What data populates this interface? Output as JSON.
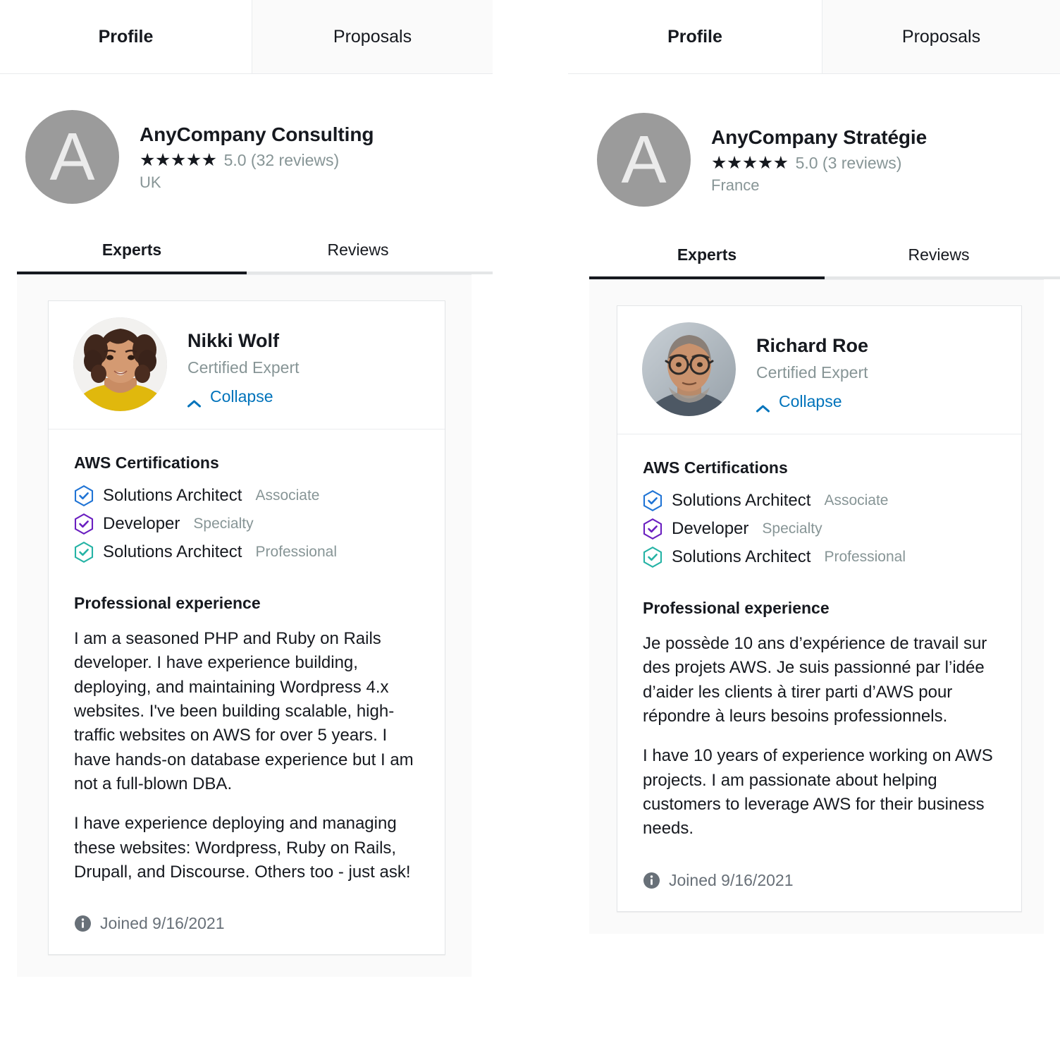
{
  "colors": {
    "accent_link": "#0073bb",
    "muted_text": "#879596",
    "body_text": "#16191f",
    "page_bg": "#ffffff",
    "content_bg": "#fafafa",
    "cert_associate": "#2074d5",
    "cert_specialty": "#6a1fc0",
    "cert_professional": "#25b3a5",
    "avatar_bg": "#9b9b9b"
  },
  "panels": [
    {
      "top_tabs": [
        {
          "label": "Profile",
          "active": true
        },
        {
          "label": "Proposals",
          "active": false
        }
      ],
      "company": {
        "avatar_letter": "A",
        "name": "AnyCompany Consulting",
        "stars": "★★★★★",
        "rating": "5.0 (32 reviews)",
        "location": "UK"
      },
      "sub_tabs": [
        {
          "label": "Experts",
          "active": true
        },
        {
          "label": "Reviews",
          "active": false
        }
      ],
      "expert": {
        "photo": "woman-curly-hair-yellow-top",
        "name": "Nikki Wolf",
        "role": "Certified Expert",
        "collapse_label": "Collapse",
        "certifications_title": "AWS Certifications",
        "certifications": [
          {
            "name": "Solutions Architect",
            "level": "Associate",
            "color": "#2074d5"
          },
          {
            "name": "Developer",
            "level": "Specialty",
            "color": "#6a1fc0"
          },
          {
            "name": "Solutions Architect",
            "level": "Professional",
            "color": "#25b3a5"
          }
        ],
        "experience_title": "Professional experience",
        "experience_paragraphs": [
          "I am a seasoned PHP and Ruby on Rails developer. I have experience building, deploying, and maintaining Wordpress 4.x websites. I've been building scalable, high-traffic websites on AWS for over 5 years. I have hands-on database experience but I am not a full-blown DBA.",
          "I have experience deploying and managing these websites: Wordpress, Ruby on Rails, Drupall, and Discourse. Others too - just ask!"
        ],
        "joined": "Joined 9/16/2021"
      }
    },
    {
      "top_tabs": [
        {
          "label": "Profile",
          "active": true
        },
        {
          "label": "Proposals",
          "active": false
        }
      ],
      "company": {
        "avatar_letter": "A",
        "name": "AnyCompany Stratégie",
        "stars": "★★★★★",
        "rating": "5.0 (3 reviews)",
        "location": "France"
      },
      "sub_tabs": [
        {
          "label": "Experts",
          "active": true
        },
        {
          "label": "Reviews",
          "active": false
        }
      ],
      "expert": {
        "photo": "bald-man-with-glasses-beard",
        "name": "Richard Roe",
        "role": "Certified Expert",
        "collapse_label": "Collapse",
        "certifications_title": "AWS Certifications",
        "certifications": [
          {
            "name": "Solutions Architect",
            "level": "Associate",
            "color": "#2074d5"
          },
          {
            "name": "Developer",
            "level": "Specialty",
            "color": "#6a1fc0"
          },
          {
            "name": "Solutions Architect",
            "level": "Professional",
            "color": "#25b3a5"
          }
        ],
        "experience_title": "Professional experience",
        "experience_paragraphs": [
          "Je possède 10 ans d’expérience de travail sur des projets AWS. Je suis passionné par l’idée d’aider les clients à tirer parti d’AWS pour répondre à leurs besoins professionnels.",
          "I have 10 years of experience working on AWS projects. I am passionate about helping customers to leverage AWS for their business needs."
        ],
        "joined": "Joined 9/16/2021"
      }
    }
  ]
}
